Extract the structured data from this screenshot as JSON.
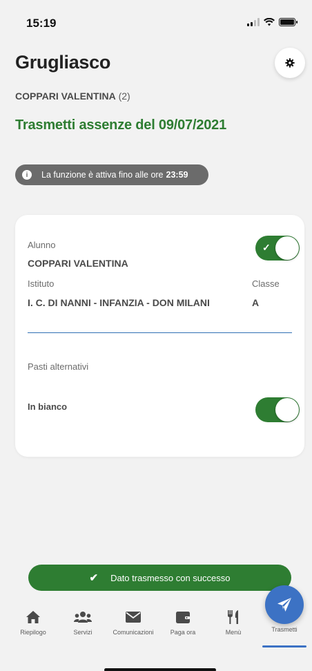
{
  "status_bar": {
    "time": "15:19"
  },
  "header": {
    "title": "Grugliasco",
    "student_name": "COPPARI VALENTINA",
    "student_count": "(2)"
  },
  "section": {
    "title": "Trasmetti assenze del 09/07/2021"
  },
  "info": {
    "text": "La funzione è attiva fino alle ore",
    "time": "23:59"
  },
  "card": {
    "student_label": "Alunno",
    "student_value": "COPPARI VALENTINA",
    "institute_label": "Istituto",
    "institute_value": "I. C. DI NANNI - INFANZIA - DON MILANI",
    "class_label": "Classe",
    "class_value": "A",
    "meals_label": "Pasti alternativi",
    "meal_option": "In bianco",
    "student_toggle_on": true,
    "meal_toggle_on": true
  },
  "toast": {
    "text": "Dato trasmesso con successo"
  },
  "tabs": [
    {
      "label": "Riepilogo",
      "icon": "home-icon"
    },
    {
      "label": "Servizi",
      "icon": "users-icon"
    },
    {
      "label": "Comunicazioni",
      "icon": "envelope-icon"
    },
    {
      "label": "Paga ora",
      "icon": "wallet-icon"
    },
    {
      "label": "Menù",
      "icon": "utensils-icon"
    },
    {
      "label": "Trasmetti",
      "icon": "send-icon"
    }
  ],
  "colors": {
    "accent_green": "#2e7d32",
    "accent_blue": "#3c72c4",
    "pill_gray": "#6b6b6b"
  }
}
